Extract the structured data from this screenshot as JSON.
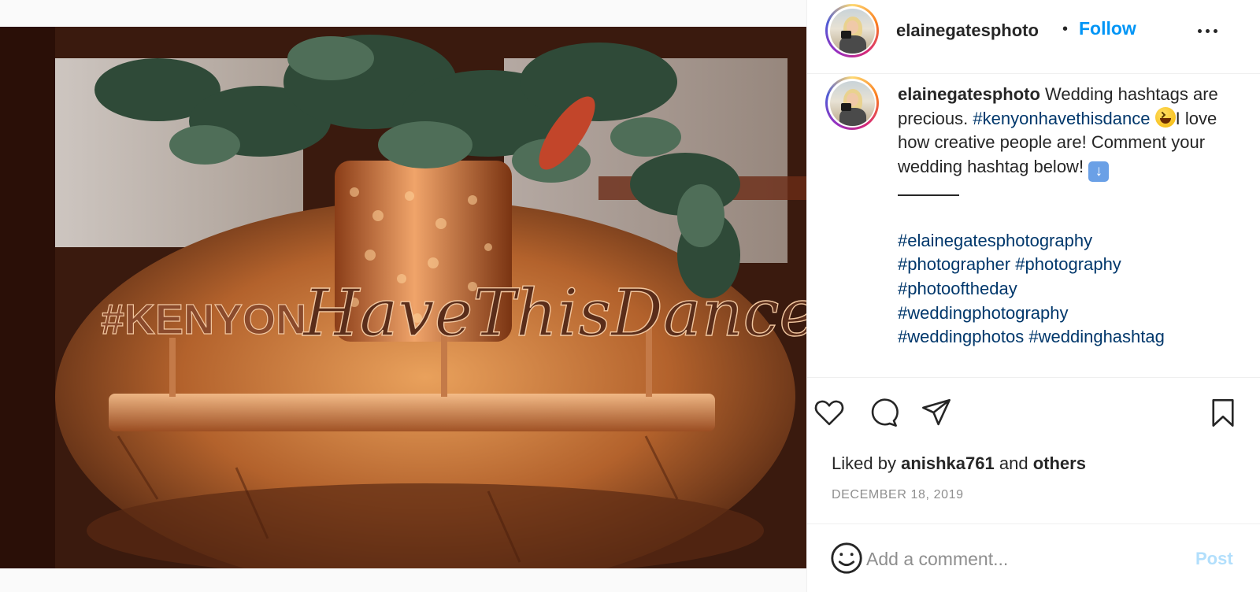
{
  "post": {
    "image_alt": "",
    "sign_text": "#KENYONHaveThisDance"
  },
  "header": {
    "username": "elainegatesphoto",
    "separator": "•",
    "follow_label": "Follow",
    "more_icon": "more-options-icon"
  },
  "caption": {
    "username": "elainegatesphoto",
    "text_1": "Wedding hashtags are precious.",
    "hashtag_1": "#kenyonhavethisdance",
    "text_2": "I love how creative people are! Comment your wedding hashtag below!",
    "hashtags": [
      "#elainegatesphotography",
      "#photographer",
      "#photography",
      "#photooftheday",
      "#weddingphotography",
      "#weddingphotos",
      "#weddinghashtag"
    ],
    "emoji_1": "grinning-squinting-face",
    "emoji_2": "down-arrow"
  },
  "actions": {
    "like_icon": "heart-icon",
    "comment_icon": "comment-icon",
    "share_icon": "paper-plane-icon",
    "save_icon": "bookmark-icon",
    "liked_by_prefix": "Liked by",
    "liked_by_user": "anishka761",
    "liked_by_and": "and",
    "liked_by_others": "others",
    "date": "DECEMBER 18, 2019"
  },
  "comment": {
    "placeholder": "Add a comment...",
    "post_label": "Post"
  },
  "colors": {
    "link_blue": "#0095f6",
    "hashtag_blue": "#00376b",
    "post_disabled": "#b2dffc",
    "muted_gray": "#8e8e8e"
  }
}
